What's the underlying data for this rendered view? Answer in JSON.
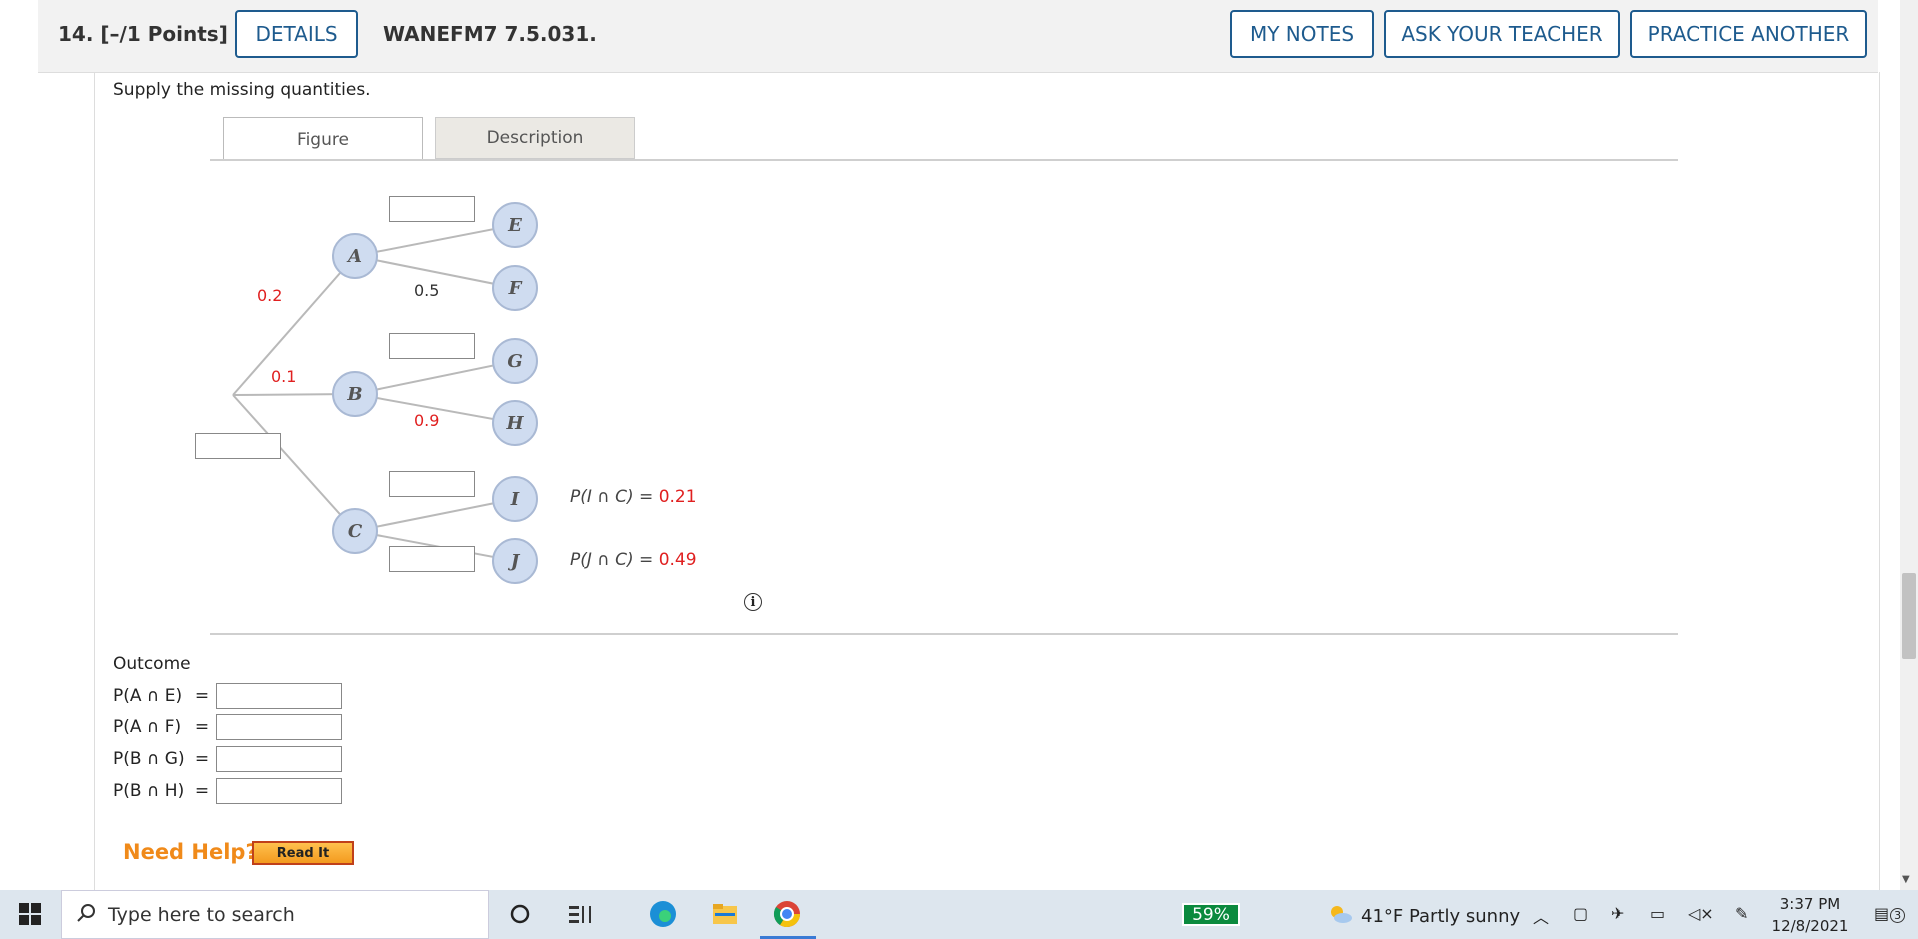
{
  "header": {
    "question_number": "14.",
    "points": "[–/1 Points]",
    "details_label": "DETAILS",
    "code": "WANEFM7 7.5.031.",
    "my_notes_label": "MY NOTES",
    "ask_teacher_label": "ASK YOUR TEACHER",
    "practice_another_label": "PRACTICE ANOTHER"
  },
  "prompt": "Supply the missing quantities.",
  "tabs": {
    "figure": "Figure",
    "description": "Description"
  },
  "tree": {
    "nodes": {
      "a": "A",
      "b": "B",
      "c": "C",
      "e": "E",
      "f": "F",
      "g": "G",
      "h": "H",
      "i": "I",
      "j": "J"
    },
    "branch_probs": {
      "root_a": "0.2",
      "root_b": "0.1",
      "a_f": "0.5",
      "b_h": "0.9"
    },
    "joint_i_label": "P(I ∩ C) = ",
    "joint_i_value": "0.21",
    "joint_j_label": "P(J ∩ C) = ",
    "joint_j_value": "0.49",
    "info_icon": "i"
  },
  "outcome": {
    "title": "Outcome",
    "rows": [
      {
        "label": "P(A ∩ E)",
        "eq": "="
      },
      {
        "label": "P(A ∩ F)",
        "eq": "="
      },
      {
        "label": "P(B ∩ G)",
        "eq": "="
      },
      {
        "label": "P(B ∩ H)",
        "eq": "="
      }
    ]
  },
  "help": {
    "need_help": "Need Help?",
    "read_it": "Read It"
  },
  "taskbar": {
    "search_placeholder": "Type here to search",
    "battery": "59%",
    "weather": "41°F  Partly sunny",
    "time": "3:37 PM",
    "date": "12/8/2021",
    "notifications": "3"
  },
  "colors": {
    "accent": "#1e5b8e",
    "given_value": "#e02020",
    "node_fill": "#cfdcf0",
    "help_orange": "#f08a1a"
  }
}
